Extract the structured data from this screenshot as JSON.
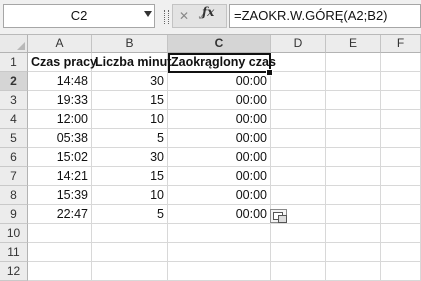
{
  "formula_bar": {
    "name_box": "C2",
    "fx_label": "fx",
    "formula": "=ZAOKR.W.GÓRĘ(A2;B2)"
  },
  "columns": [
    "A",
    "B",
    "C",
    "D",
    "E",
    "F"
  ],
  "rows": [
    "1",
    "2",
    "3",
    "4",
    "5",
    "6",
    "7",
    "8",
    "9",
    "10",
    "11",
    "12"
  ],
  "sheet": {
    "headers": [
      "Czas pracy",
      "Liczba minut",
      "Zaokrąglony czas"
    ],
    "data": [
      [
        "14:48",
        "30",
        "00:00"
      ],
      [
        "19:33",
        "15",
        "00:00"
      ],
      [
        "12:00",
        "10",
        "00:00"
      ],
      [
        "05:38",
        "5",
        "00:00"
      ],
      [
        "15:02",
        "30",
        "00:00"
      ],
      [
        "14:21",
        "15",
        "00:00"
      ],
      [
        "15:39",
        "10",
        "00:00"
      ],
      [
        "22:47",
        "5",
        "00:00"
      ]
    ]
  },
  "active_cell": "C2"
}
